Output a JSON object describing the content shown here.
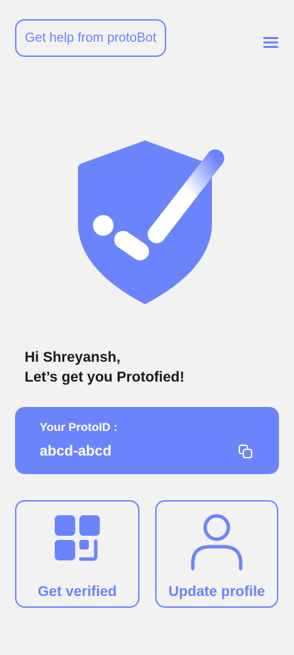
{
  "header": {
    "help_button_label": "Get help from protoBot"
  },
  "greeting": {
    "line1": "Hi Shreyansh,",
    "line2": "Let’s get you Protofied!"
  },
  "proto_id": {
    "label": "Your ProtoID :",
    "value": "abcd-abcd"
  },
  "actions": {
    "verify_label": "Get verified",
    "profile_label": "Update profile"
  },
  "icons": {
    "menu": "hamburger-menu-icon",
    "hero": "shield-check-icon",
    "copy": "copy-icon",
    "verify": "qr-code-icon",
    "profile": "user-icon"
  },
  "colors": {
    "accent": "#6c84fb",
    "background": "#f2f2f2",
    "text": "#1a1a1a"
  }
}
